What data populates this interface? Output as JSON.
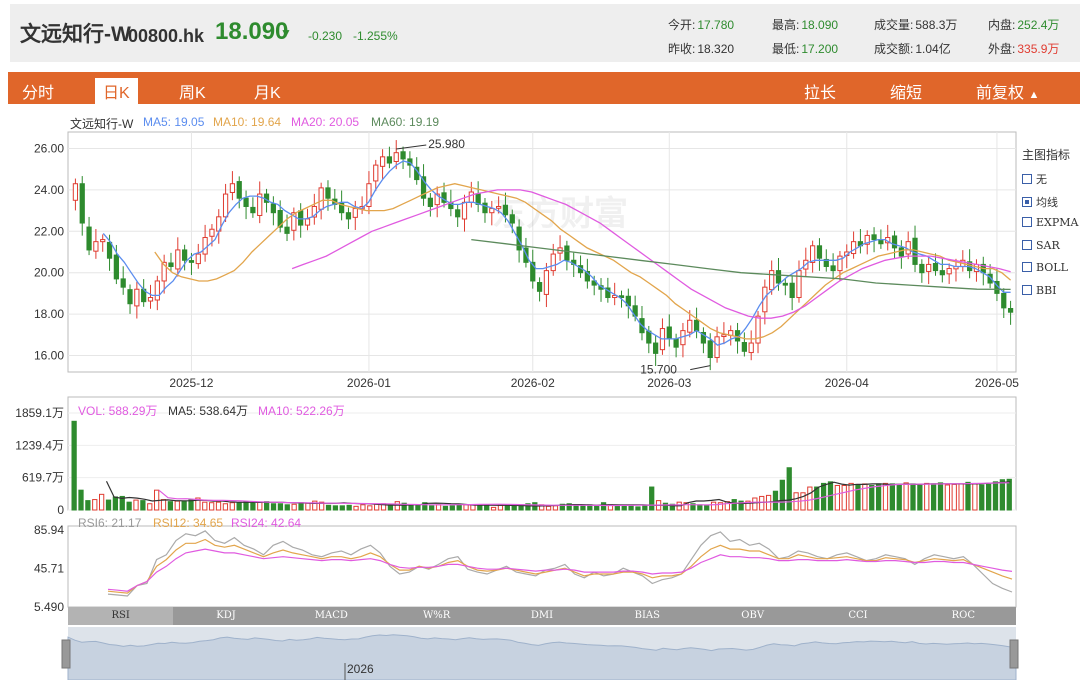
{
  "header": {
    "name": "文远知行-W",
    "code": "00800.hk",
    "price": "18.090",
    "change": "-0.230",
    "change_pct": "-1.255%",
    "stats": [
      {
        "label": "今开:",
        "value": "17.780",
        "color": "green"
      },
      {
        "label": "最高:",
        "value": "18.090",
        "color": "green"
      },
      {
        "label": "成交量:",
        "value": "588.3万",
        "color": "plain"
      },
      {
        "label": "内盘:",
        "value": "252.4万",
        "color": "green"
      },
      {
        "label": "昨收:",
        "value": "18.320",
        "color": "plain"
      },
      {
        "label": "最低:",
        "value": "17.200",
        "color": "green"
      },
      {
        "label": "成交额:",
        "value": "1.04亿",
        "color": "plain"
      },
      {
        "label": "外盘:",
        "value": "335.9万",
        "color": "red"
      }
    ]
  },
  "tabs": {
    "fenshi": "分时",
    "rik": "日K",
    "zhouk": "周K",
    "yuek": "月K",
    "lachang": "拉长",
    "suoduan": "缩短",
    "fuquan": "前复权"
  },
  "main_legend": {
    "name": "文远知行-W",
    "ma5": "MA5: 19.05",
    "ma10": "MA10: 19.64",
    "ma20": "MA20: 20.05",
    "ma60": "MA60: 19.19"
  },
  "vol_legend": {
    "vol": "VOL: 588.29万",
    "ma5": "MA5: 538.64万",
    "ma10": "MA10: 522.26万"
  },
  "rsi_legend": {
    "rsi6": "RSI6: 21.17",
    "rsi12": "RSI12: 34.65",
    "rsi24": "RSI24: 42.64"
  },
  "side": {
    "title": "主图指标",
    "items": [
      "无",
      "均线",
      "EXPMA",
      "SAR",
      "BOLL",
      "BBI"
    ],
    "selected": 1
  },
  "indicator_tabs": [
    "RSI",
    "KDJ",
    "MACD",
    "W%R",
    "DMI",
    "BIAS",
    "OBV",
    "CCI",
    "ROC"
  ],
  "navigator_label": "2026",
  "colors": {
    "up": "#e03c31",
    "down": "#2e8b2e",
    "ma5": "#5b8def",
    "ma10": "#e2a54c",
    "ma20": "#e05be0",
    "ma60": "#5c8a5c",
    "accent": "#e0662a"
  },
  "watermark": "东方财富",
  "chart_data": [
    {
      "type": "candlestick",
      "title": "文远知行-W",
      "y_ticks": [
        "26.00",
        "24.00",
        "22.00",
        "20.00",
        "18.00",
        "16.00"
      ],
      "ylim": [
        15.2,
        26.8
      ],
      "x_ticks": [
        "2025-12",
        "2026-01",
        "2026-02",
        "2026-03",
        "2026-04",
        "2026-05"
      ],
      "annotations": [
        {
          "text": "25.980",
          "kind": "high"
        },
        {
          "text": "15.700",
          "kind": "low"
        }
      ],
      "closes": [
        24.3,
        22.4,
        21.1,
        21.5,
        21.6,
        20.7,
        19.7,
        19.3,
        18.5,
        19.2,
        18.6,
        18.8,
        19.6,
        20.5,
        20.3,
        21.1,
        20.6,
        20.5,
        20.9,
        21.7,
        22.1,
        22.7,
        23.8,
        24.3,
        23.6,
        23.2,
        22.9,
        23.8,
        23.4,
        22.9,
        22.2,
        21.9,
        22.9,
        22.3,
        22.6,
        23.2,
        24.1,
        23.6,
        23.3,
        22.9,
        22.6,
        23.1,
        23.2,
        24.3,
        25.2,
        25.6,
        25.3,
        25.8,
        25.5,
        25.2,
        24.5,
        23.6,
        23.2,
        23.8,
        23.4,
        23.1,
        22.7,
        23.4,
        23.9,
        23.3,
        22.9,
        23.1,
        23.2,
        22.8,
        22.4,
        21.1,
        20.5,
        19.6,
        19.1,
        20.1,
        20.9,
        21.2,
        20.6,
        20.4,
        20.0,
        19.6,
        19.4,
        19.2,
        18.8,
        18.9,
        18.8,
        18.4,
        17.9,
        17.1,
        16.6,
        16.1,
        17.3,
        16.8,
        16.4,
        17.2,
        17.7,
        17.2,
        16.6,
        15.9,
        16.9,
        17.0,
        17.2,
        16.7,
        16.2,
        16.6,
        17.9,
        19.3,
        20.1,
        19.5,
        19.4,
        18.8,
        20.1,
        20.6,
        21.3,
        20.7,
        20.3,
        20.1,
        20.8,
        21.0,
        21.5,
        21.3,
        21.8,
        21.6,
        21.4,
        21.7,
        21.2,
        20.8,
        21.5,
        20.4,
        20.0,
        20.4,
        20.1,
        19.9,
        20.2,
        20.3,
        20.6,
        20.1,
        20.4,
        20.0,
        19.5,
        19.0,
        18.3,
        18.09
      ],
      "ma5": [
        null,
        null,
        null,
        null,
        21.9,
        21.5,
        20.9,
        20.5,
        20.0,
        19.5,
        19.1,
        18.9,
        18.9,
        19.3,
        19.6,
        20.1,
        20.6,
        20.9,
        21.0,
        21.3,
        21.6,
        22.3,
        22.9,
        23.3,
        23.6,
        23.7,
        23.7,
        23.6,
        23.4,
        23.3,
        23.0,
        22.8,
        22.6,
        22.6,
        22.7,
        23.0,
        23.2,
        23.3,
        23.4,
        23.4,
        23.2,
        23.1,
        23.4,
        24.0,
        24.5,
        24.9,
        25.2,
        25.4,
        25.3,
        24.9,
        24.4,
        24.0,
        23.7,
        23.5,
        23.3,
        23.3,
        23.4,
        23.4,
        23.3,
        23.2,
        23.1,
        22.9,
        22.5,
        21.9,
        21.3,
        20.6,
        20.2,
        20.2,
        20.3,
        20.4,
        20.6,
        20.5,
        20.3,
        20.1,
        19.8,
        19.4,
        19.2,
        19.0,
        18.8,
        18.5,
        18.0,
        17.5,
        17.2,
        17.0,
        16.8,
        16.8,
        16.8,
        16.9,
        17.0,
        17.2,
        17.0,
        16.8,
        16.5,
        16.6,
        16.8,
        16.9,
        17.3,
        17.8,
        18.4,
        18.9,
        19.2,
        19.5,
        19.8,
        20.0,
        20.2,
        20.5,
        20.6,
        20.6,
        20.6,
        20.6,
        20.7,
        21.0,
        21.2,
        21.4,
        21.5,
        21.6,
        21.6,
        21.4,
        21.3,
        21.2,
        21.0,
        20.9,
        20.8,
        20.6,
        20.4,
        20.4,
        20.3,
        20.3,
        20.3,
        20.2,
        20.0,
        19.8,
        19.4,
        19.05,
        19.05
      ],
      "ma10": [
        null,
        null,
        null,
        null,
        null,
        null,
        null,
        null,
        null,
        21.0,
        20.4,
        20.0,
        19.8,
        19.7,
        19.6,
        19.6,
        19.7,
        19.9,
        20.1,
        20.5,
        21.0,
        21.4,
        21.8,
        22.2,
        22.6,
        22.9,
        23.1,
        23.3,
        23.5,
        23.5,
        23.3,
        23.2,
        23.1,
        23.0,
        23.0,
        23.0,
        23.1,
        23.3,
        23.5,
        23.7,
        23.9,
        24.1,
        24.2,
        24.3,
        24.2,
        24.1,
        24.0,
        23.9,
        23.8,
        23.7,
        23.6,
        23.4,
        23.1,
        22.8,
        22.5,
        22.1,
        21.8,
        21.5,
        21.2,
        21.0,
        20.8,
        20.6,
        20.3,
        20.0,
        19.8,
        19.5,
        19.2,
        18.9,
        18.5,
        18.2,
        17.9,
        17.6,
        17.3,
        17.1,
        17.0,
        16.9,
        16.8,
        16.8,
        16.9,
        17.1,
        17.4,
        17.8,
        18.2,
        18.6,
        19.0,
        19.4,
        19.7,
        20.0,
        20.2,
        20.4,
        20.6,
        20.8,
        20.9,
        21.0,
        21.1,
        21.1,
        21.0,
        20.9,
        20.8,
        20.6,
        20.5,
        20.4,
        20.3,
        20.2,
        20.2,
        20.0,
        19.64
      ],
      "ma20": [
        null,
        null,
        null,
        null,
        null,
        null,
        null,
        null,
        null,
        null,
        null,
        null,
        null,
        null,
        null,
        null,
        null,
        null,
        null,
        20.2,
        20.4,
        20.6,
        20.8,
        21.1,
        21.4,
        21.7,
        22.0,
        22.2,
        22.4,
        22.6,
        22.8,
        23.0,
        23.2,
        23.4,
        23.6,
        23.8,
        23.9,
        24.0,
        24.0,
        24.0,
        23.9,
        23.7,
        23.5,
        23.3,
        23.0,
        22.7,
        22.4,
        22.0,
        21.6,
        21.2,
        20.8,
        20.4,
        20.0,
        19.6,
        19.2,
        18.9,
        18.6,
        18.3,
        18.1,
        17.9,
        17.8,
        17.8,
        17.9,
        18.1,
        18.4,
        18.8,
        19.2,
        19.6,
        19.9,
        20.2,
        20.4,
        20.6,
        20.7,
        20.8,
        20.8,
        20.8,
        20.7,
        20.6,
        20.5,
        20.4,
        20.3,
        20.2,
        20.05
      ],
      "ma60": [
        21.6,
        21.4,
        21.2,
        21.0,
        20.8,
        20.6,
        20.4,
        20.2,
        20.0,
        19.9,
        19.8,
        19.7,
        19.5,
        19.4,
        19.3,
        19.2,
        19.19
      ]
    },
    {
      "type": "bar",
      "title": "VOL",
      "y_ticks": [
        "1859.1万",
        "1239.4万",
        "619.7万",
        "0"
      ],
      "ylim": [
        0,
        1859.1
      ],
      "values": [
        1700,
        380,
        180,
        200,
        300,
        190,
        250,
        260,
        150,
        190,
        180,
        120,
        380,
        200,
        160,
        170,
        170,
        200,
        230,
        150,
        140,
        150,
        120,
        140,
        140,
        160,
        130,
        150,
        160,
        120,
        120,
        100,
        110,
        140,
        130,
        170,
        150,
        90,
        80,
        80,
        90,
        70,
        100,
        80,
        110,
        120,
        100,
        160,
        130,
        90,
        100,
        140,
        80,
        100,
        70,
        80,
        100,
        100,
        100,
        80,
        90,
        50,
        90,
        80,
        80,
        100,
        120,
        140,
        100,
        70,
        80,
        110,
        120,
        90,
        80,
        100,
        80,
        140,
        100,
        90,
        80,
        80,
        60,
        80,
        440,
        180,
        130,
        110,
        150,
        140,
        120,
        100,
        90,
        150,
        140,
        160,
        200,
        170,
        170,
        230,
        260,
        280,
        360,
        570,
        810,
        330,
        330,
        440,
        440,
        510,
        540,
        470,
        470,
        510,
        480,
        500,
        470,
        500,
        510,
        500,
        490,
        520,
        500,
        470,
        510,
        500,
        520,
        480,
        490,
        500,
        530,
        500,
        480,
        490,
        540,
        580,
        588.29
      ],
      "ma5": [
        null,
        null,
        null,
        null,
        552,
        250,
        222,
        240,
        228,
        206,
        172,
        186,
        193,
        180,
        177,
        176,
        189,
        184,
        170,
        175,
        158,
        149,
        148,
        148,
        146,
        150,
        148,
        146,
        140,
        136,
        134,
        126,
        128,
        128,
        128,
        138,
        128,
        122,
        122,
        112,
        104,
        92,
        96,
        94,
        99,
        104,
        128,
        132,
        128,
        120,
        116,
        106,
        94,
        94,
        92,
        90,
        92,
        88,
        86,
        80,
        76,
        78,
        82,
        90,
        99,
        103,
        104,
        100,
        92,
        98,
        102,
        100,
        100,
        98,
        98,
        94,
        90,
        92,
        80,
        80,
        142,
        172,
        172,
        184,
        202,
        152,
        132,
        124,
        132,
        142,
        150,
        160,
        180,
        190,
        214,
        260,
        330,
        438,
        490,
        532,
        496,
        478,
        492,
        490,
        500,
        500,
        490,
        492,
        494,
        496,
        490,
        498,
        500,
        500,
        500,
        500,
        500,
        500,
        502,
        510,
        520,
        530,
        538.64
      ],
      "ma10": [
        null,
        null,
        null,
        null,
        null,
        null,
        null,
        null,
        null,
        380,
        236,
        214,
        216,
        203,
        190,
        184,
        186,
        180,
        174,
        166,
        158,
        152,
        148,
        142,
        140,
        138,
        136,
        132,
        130,
        128,
        126,
        124,
        122,
        120,
        118,
        114,
        110,
        106,
        102,
        100,
        100,
        100,
        102,
        104,
        108,
        110,
        112,
        110,
        106,
        102,
        98,
        94,
        92,
        90,
        90,
        90,
        90,
        88,
        86,
        86,
        88,
        90,
        92,
        94,
        96,
        98,
        100,
        102,
        100,
        98,
        104,
        120,
        130,
        140,
        150,
        150,
        150,
        152,
        158,
        168,
        186,
        220,
        260,
        300,
        340,
        380,
        410,
        440,
        460,
        480,
        490,
        492,
        494,
        496,
        498,
        500,
        502,
        505,
        508,
        512,
        516,
        520,
        522.26
      ]
    },
    {
      "type": "line",
      "title": "RSI",
      "y_ticks": [
        "85.94",
        "45.71",
        "5.490"
      ],
      "ylim": [
        5.49,
        85.94
      ],
      "series": [
        {
          "name": "RSI6",
          "values": [
            19,
            18,
            17,
            28,
            30,
            55,
            60,
            75,
            82,
            80,
            85,
            75,
            72,
            78,
            70,
            66,
            60,
            70,
            74,
            68,
            65,
            60,
            58,
            62,
            64,
            60,
            66,
            70,
            62,
            48,
            40,
            42,
            48,
            45,
            50,
            56,
            58,
            45,
            42,
            40,
            44,
            48,
            42,
            40,
            38,
            44,
            46,
            50,
            40,
            36,
            42,
            38,
            40,
            46,
            42,
            38,
            30,
            34,
            36,
            40,
            55,
            70,
            80,
            84,
            74,
            76,
            70,
            72,
            66,
            56,
            58,
            64,
            62,
            58,
            56,
            60,
            62,
            58,
            54,
            56,
            60,
            58,
            56,
            50,
            56,
            60,
            58,
            56,
            58,
            50,
            40,
            30,
            25,
            21.17
          ]
        },
        {
          "name": "RSI12",
          "values": [
            22,
            21,
            20,
            28,
            32,
            48,
            55,
            65,
            72,
            72,
            76,
            70,
            68,
            70,
            66,
            62,
            58,
            62,
            65,
            62,
            60,
            58,
            56,
            58,
            58,
            56,
            58,
            62,
            58,
            50,
            44,
            44,
            48,
            46,
            48,
            52,
            54,
            48,
            44,
            43,
            44,
            46,
            44,
            42,
            40,
            42,
            44,
            46,
            42,
            38,
            40,
            40,
            40,
            42,
            42,
            40,
            36,
            38,
            38,
            40,
            48,
            58,
            66,
            70,
            66,
            66,
            64,
            64,
            60,
            56,
            56,
            60,
            58,
            56,
            56,
            57,
            58,
            56,
            54,
            54,
            57,
            56,
            55,
            52,
            54,
            56,
            55,
            54,
            55,
            50,
            46,
            42,
            38,
            34.65
          ]
        },
        {
          "name": "RSI24",
          "values": [
            24,
            23,
            22,
            28,
            32,
            42,
            48,
            56,
            62,
            64,
            66,
            64,
            62,
            62,
            60,
            58,
            56,
            57,
            58,
            57,
            56,
            55,
            54,
            55,
            55,
            54,
            55,
            56,
            54,
            50,
            47,
            46,
            47,
            47,
            48,
            50,
            50,
            48,
            46,
            45,
            45,
            46,
            45,
            44,
            43,
            44,
            44,
            45,
            44,
            42,
            42,
            42,
            42,
            43,
            43,
            42,
            40,
            41,
            41,
            42,
            46,
            52,
            56,
            60,
            58,
            58,
            57,
            57,
            56,
            54,
            54,
            55,
            55,
            54,
            54,
            54,
            55,
            54,
            53,
            53,
            54,
            54,
            53,
            52,
            52,
            53,
            53,
            52,
            52,
            50,
            48,
            46,
            44,
            42.64
          ]
        }
      ]
    }
  ]
}
